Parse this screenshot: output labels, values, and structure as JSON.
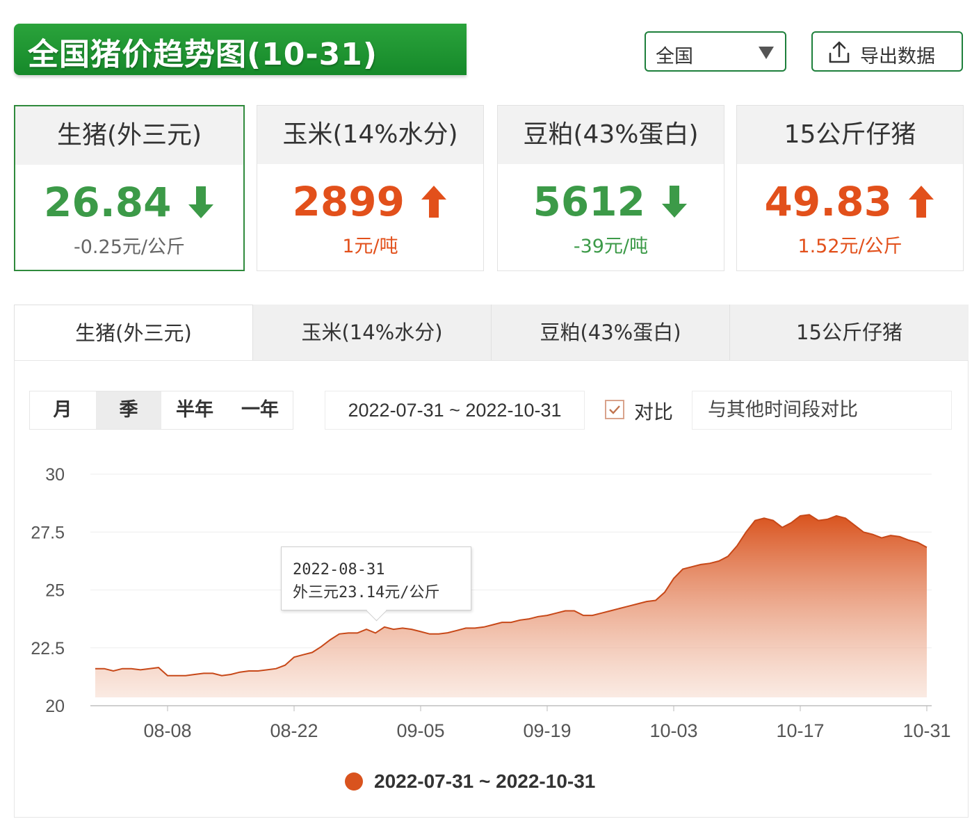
{
  "header": {
    "title": "全国猪价趋势图(10-31)",
    "region": "全国",
    "export_label": "导出数据"
  },
  "cards": [
    {
      "name": "生猪(外三元)",
      "price": "26.84",
      "change": "-0.25元/公斤",
      "trend": "down",
      "active": true
    },
    {
      "name": "玉米(14%水分)",
      "price": "2899",
      "change": "1元/吨",
      "trend": "up",
      "active": false
    },
    {
      "name": "豆粕(43%蛋白)",
      "price": "5612",
      "change": "-39元/吨",
      "trend": "down",
      "active": false
    },
    {
      "name": "15公斤仔猪",
      "price": "49.83",
      "change": "1.52元/公斤",
      "trend": "up",
      "active": false
    }
  ],
  "tabs": [
    "生猪(外三元)",
    "玉米(14%水分)",
    "豆粕(43%蛋白)",
    "15公斤仔猪"
  ],
  "controls": {
    "ranges": [
      "月",
      "季",
      "半年",
      "一年"
    ],
    "active_range": "季",
    "date_range": "2022-07-31 ~ 2022-10-31",
    "compare_label": "对比",
    "compare_checked": true,
    "compare_placeholder": "与其他时间段对比"
  },
  "tooltip": {
    "date": "2022-08-31",
    "value_text": "外三元23.14元/公斤"
  },
  "colors": {
    "up": "#e2501b",
    "down": "#3c9a48",
    "series": "#d9531e",
    "brand": "#16892a"
  },
  "chart_data": {
    "type": "area",
    "title": "",
    "xlabel": "",
    "ylabel": "",
    "ylim": [
      20,
      30
    ],
    "yticks": [
      "30",
      "27.5",
      "25",
      "22.5",
      "20"
    ],
    "xticks": [
      "08-08",
      "08-22",
      "09-05",
      "09-19",
      "10-03",
      "10-17",
      "10-31"
    ],
    "legend": "bottom-center",
    "series": [
      {
        "name": "2022-07-31 ~ 2022-10-31",
        "x": [
          "2022-07-31",
          "2022-08-01",
          "2022-08-02",
          "2022-08-03",
          "2022-08-04",
          "2022-08-05",
          "2022-08-06",
          "2022-08-07",
          "2022-08-08",
          "2022-08-09",
          "2022-08-10",
          "2022-08-11",
          "2022-08-12",
          "2022-08-13",
          "2022-08-14",
          "2022-08-15",
          "2022-08-16",
          "2022-08-17",
          "2022-08-18",
          "2022-08-19",
          "2022-08-20",
          "2022-08-21",
          "2022-08-22",
          "2022-08-23",
          "2022-08-24",
          "2022-08-25",
          "2022-08-26",
          "2022-08-27",
          "2022-08-28",
          "2022-08-29",
          "2022-08-30",
          "2022-08-31",
          "2022-09-01",
          "2022-09-02",
          "2022-09-03",
          "2022-09-04",
          "2022-09-05",
          "2022-09-06",
          "2022-09-07",
          "2022-09-08",
          "2022-09-09",
          "2022-09-10",
          "2022-09-11",
          "2022-09-12",
          "2022-09-13",
          "2022-09-14",
          "2022-09-15",
          "2022-09-16",
          "2022-09-17",
          "2022-09-18",
          "2022-09-19",
          "2022-09-20",
          "2022-09-21",
          "2022-09-22",
          "2022-09-23",
          "2022-09-24",
          "2022-09-25",
          "2022-09-26",
          "2022-09-27",
          "2022-09-28",
          "2022-09-29",
          "2022-09-30",
          "2022-10-01",
          "2022-10-02",
          "2022-10-03",
          "2022-10-04",
          "2022-10-05",
          "2022-10-06",
          "2022-10-07",
          "2022-10-08",
          "2022-10-09",
          "2022-10-10",
          "2022-10-11",
          "2022-10-12",
          "2022-10-13",
          "2022-10-14",
          "2022-10-15",
          "2022-10-16",
          "2022-10-17",
          "2022-10-18",
          "2022-10-19",
          "2022-10-20",
          "2022-10-21",
          "2022-10-22",
          "2022-10-23",
          "2022-10-24",
          "2022-10-25",
          "2022-10-26",
          "2022-10-27",
          "2022-10-28",
          "2022-10-29",
          "2022-10-30",
          "2022-10-31"
        ],
        "values": [
          21.6,
          21.6,
          21.5,
          21.6,
          21.6,
          21.55,
          21.6,
          21.65,
          21.3,
          21.3,
          21.3,
          21.35,
          21.4,
          21.4,
          21.3,
          21.35,
          21.45,
          21.5,
          21.5,
          21.55,
          21.6,
          21.75,
          22.1,
          22.2,
          22.3,
          22.55,
          22.85,
          23.1,
          23.14,
          23.14,
          23.3,
          23.14,
          23.4,
          23.3,
          23.35,
          23.3,
          23.2,
          23.1,
          23.1,
          23.15,
          23.25,
          23.35,
          23.35,
          23.4,
          23.5,
          23.6,
          23.6,
          23.7,
          23.75,
          23.85,
          23.9,
          24.0,
          24.1,
          24.1,
          23.9,
          23.9,
          24.0,
          24.1,
          24.2,
          24.3,
          24.4,
          24.5,
          24.55,
          24.9,
          25.5,
          25.9,
          26.0,
          26.1,
          26.15,
          26.25,
          26.45,
          26.9,
          27.5,
          28.0,
          28.1,
          28.0,
          27.7,
          27.9,
          28.2,
          28.25,
          28.0,
          28.05,
          28.2,
          28.1,
          27.8,
          27.5,
          27.4,
          27.25,
          27.35,
          27.3,
          27.15,
          27.05,
          26.84
        ]
      }
    ]
  }
}
